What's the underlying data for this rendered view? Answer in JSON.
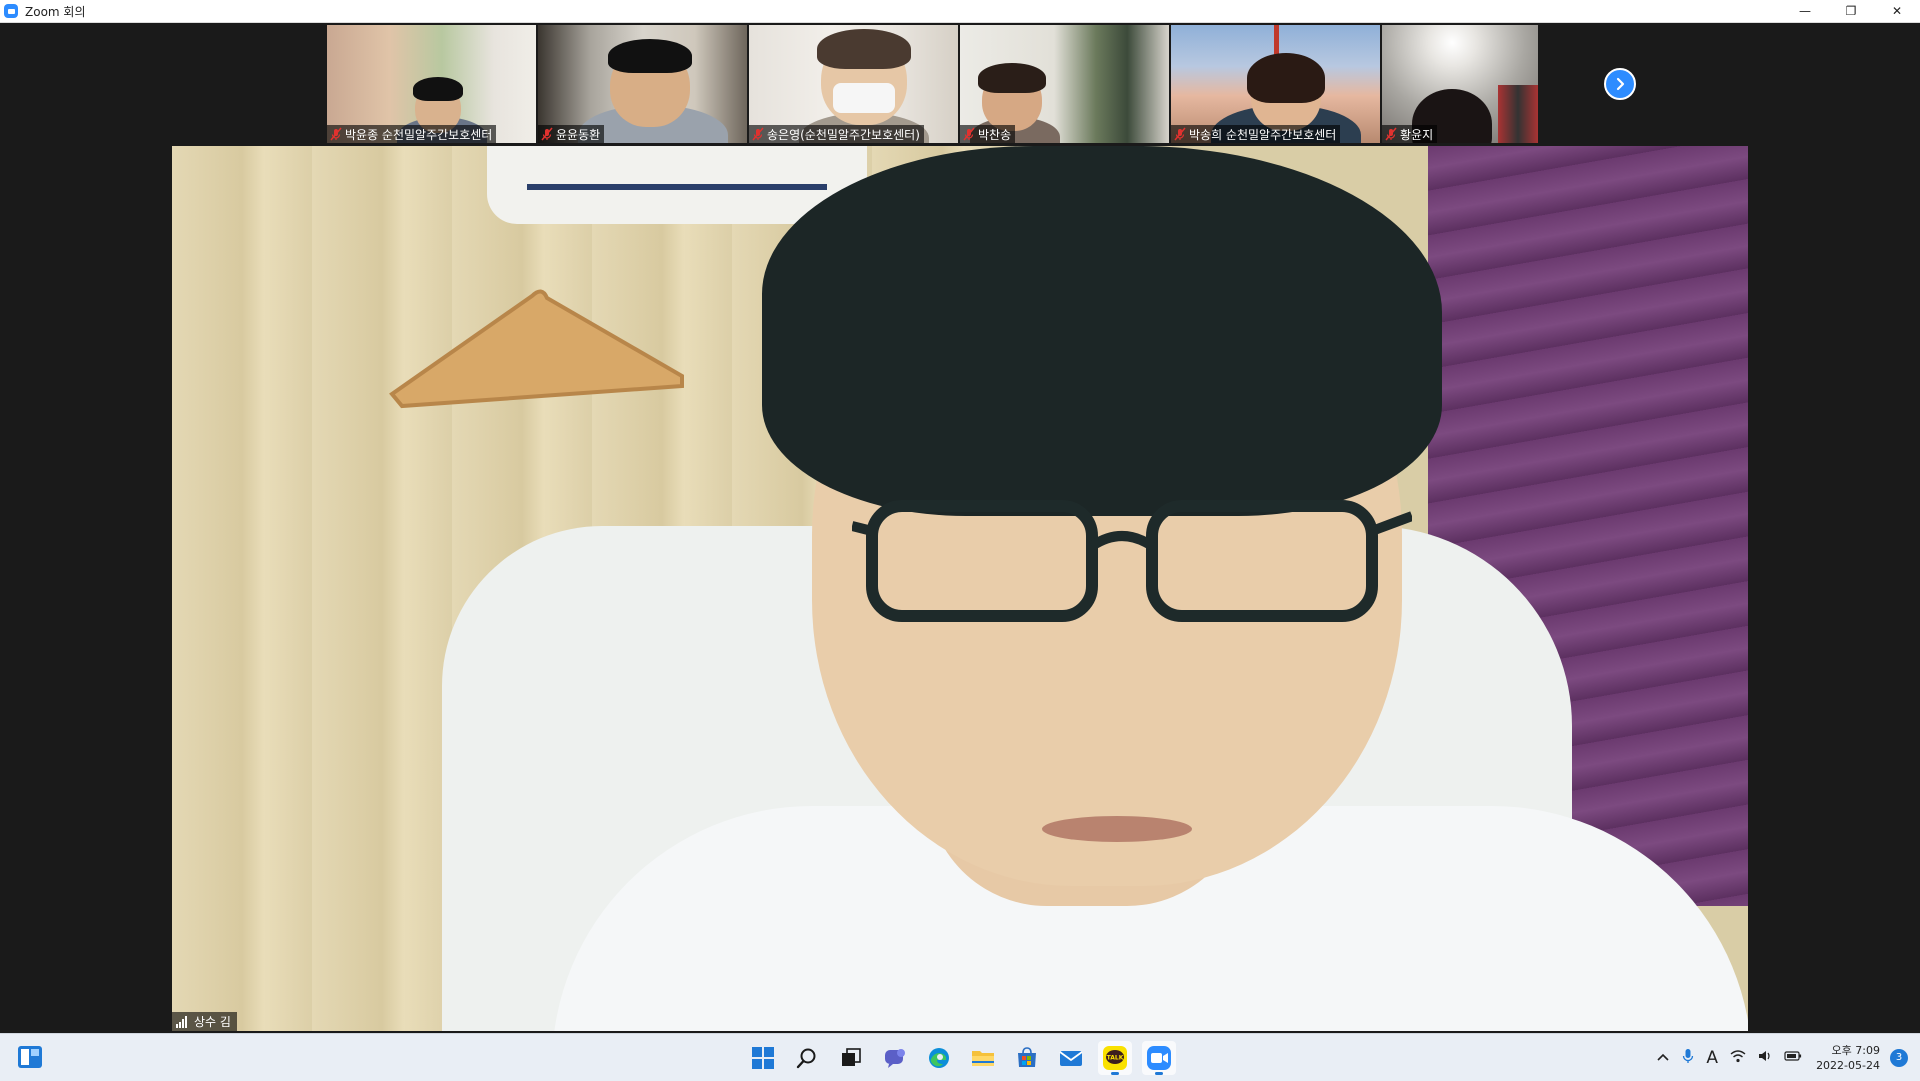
{
  "window": {
    "title": "Zoom 회의",
    "minimize_glyph": "—",
    "maximize_glyph": "❐",
    "close_glyph": "✕"
  },
  "participants": [
    {
      "name": "박윤종 순천밀알주간보호센터",
      "mic": "muted",
      "icon": "mic-muted-icon"
    },
    {
      "name": "윤윤동환",
      "mic": "muted",
      "icon": "mic-muted-icon"
    },
    {
      "name": "송은영(순천밀알주간보호센터)",
      "mic": "muted",
      "icon": "mic-muted-icon"
    },
    {
      "name": "박찬송",
      "mic": "muted",
      "icon": "mic-muted-icon"
    },
    {
      "name": "박송희 순천밀알주간보호센터",
      "mic": "muted",
      "icon": "mic-muted-icon"
    },
    {
      "name": "황윤지",
      "mic": "muted",
      "icon": "mic-muted-icon"
    }
  ],
  "active_speaker": {
    "name": "상수 김",
    "icon": "signal-strength-icon"
  },
  "taskbar": {
    "center_icons": [
      "windows-start-icon",
      "search-icon",
      "task-view-icon",
      "chat-icon",
      "edge-icon",
      "file-explorer-icon",
      "store-icon",
      "mail-icon",
      "kakaotalk-icon",
      "zoom-icon"
    ],
    "kakaotalk_label": "TALK",
    "tray": {
      "ime": "A",
      "time": "오후 7:09",
      "date": "2022-05-24",
      "notifications": "3"
    }
  },
  "colors": {
    "zoom_blue": "#2d8cff",
    "muted_red": "#e0322f",
    "taskbar_bg": "#e9eef5"
  }
}
